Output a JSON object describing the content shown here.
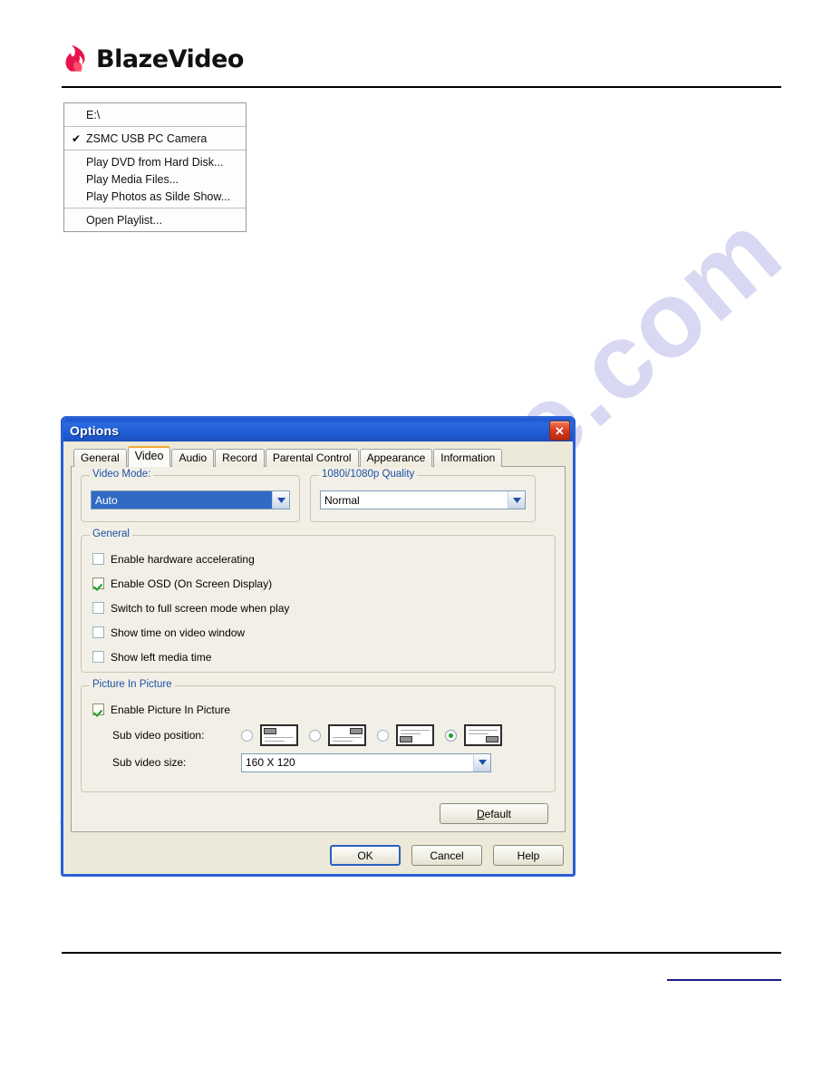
{
  "header": {
    "logo_text_blaze": "BlazeVideo",
    "logo_icon": "flame-icon"
  },
  "context_menu": {
    "groups": [
      {
        "items": [
          {
            "label": "E:\\",
            "checked": false
          }
        ]
      },
      {
        "items": [
          {
            "label": "ZSMC USB PC Camera",
            "checked": true,
            "check_glyph": "✔"
          }
        ]
      },
      {
        "items": [
          {
            "label": "Play DVD from Hard Disk...",
            "checked": false
          },
          {
            "label": "Play Media Files...",
            "checked": false
          },
          {
            "label": "Play Photos as Silde Show...",
            "checked": false
          }
        ]
      },
      {
        "items": [
          {
            "label": "Open Playlist...",
            "checked": false
          }
        ]
      }
    ]
  },
  "dialog": {
    "title": "Options",
    "close_label": "✕",
    "tabs": [
      {
        "label": "General",
        "active": false
      },
      {
        "label": "Video",
        "active": true
      },
      {
        "label": "Audio",
        "active": false
      },
      {
        "label": "Record",
        "active": false
      },
      {
        "label": "Parental Control",
        "active": false
      },
      {
        "label": "Appearance",
        "active": false
      },
      {
        "label": "Information",
        "active": false
      }
    ],
    "video_mode": {
      "group_label": "Video Mode:",
      "value": "Auto"
    },
    "quality": {
      "group_label": "1080i/1080p Quality",
      "value": "Normal"
    },
    "general": {
      "group_label": "General",
      "options": [
        {
          "label": "Enable hardware accelerating",
          "checked": false
        },
        {
          "label": "Enable OSD (On Screen Display)",
          "checked": true
        },
        {
          "label": "Switch to full screen mode when play",
          "checked": false
        },
        {
          "label": "Show time on video window",
          "checked": false
        },
        {
          "label": "Show left media time",
          "checked": false
        }
      ]
    },
    "pip": {
      "group_label": "Picture In Picture",
      "enable_label": "Enable Picture In Picture",
      "enable_checked": true,
      "position_label": "Sub video position:",
      "positions": [
        {
          "name": "top-left",
          "selected": false
        },
        {
          "name": "top-right",
          "selected": false
        },
        {
          "name": "bottom-left",
          "selected": false
        },
        {
          "name": "bottom-right",
          "selected": true
        }
      ],
      "size_label": "Sub video size:",
      "size_value": "160 X 120"
    },
    "buttons": {
      "default_label": "Default",
      "default_accel": "D",
      "default_rest": "efault",
      "ok_label": "OK",
      "cancel_label": "Cancel",
      "help_label": "Help"
    }
  },
  "watermark": {
    "text": "manualshive.com"
  },
  "colors": {
    "title_bar_blue": "#2a5fd4",
    "group_label_blue": "#1d4fa8",
    "active_tab_accent": "#f0a832",
    "selection_blue": "#316ac5",
    "check_green": "#1a9e28",
    "close_red": "#d93b21",
    "footer_link_navy": "#1b1b8f"
  }
}
